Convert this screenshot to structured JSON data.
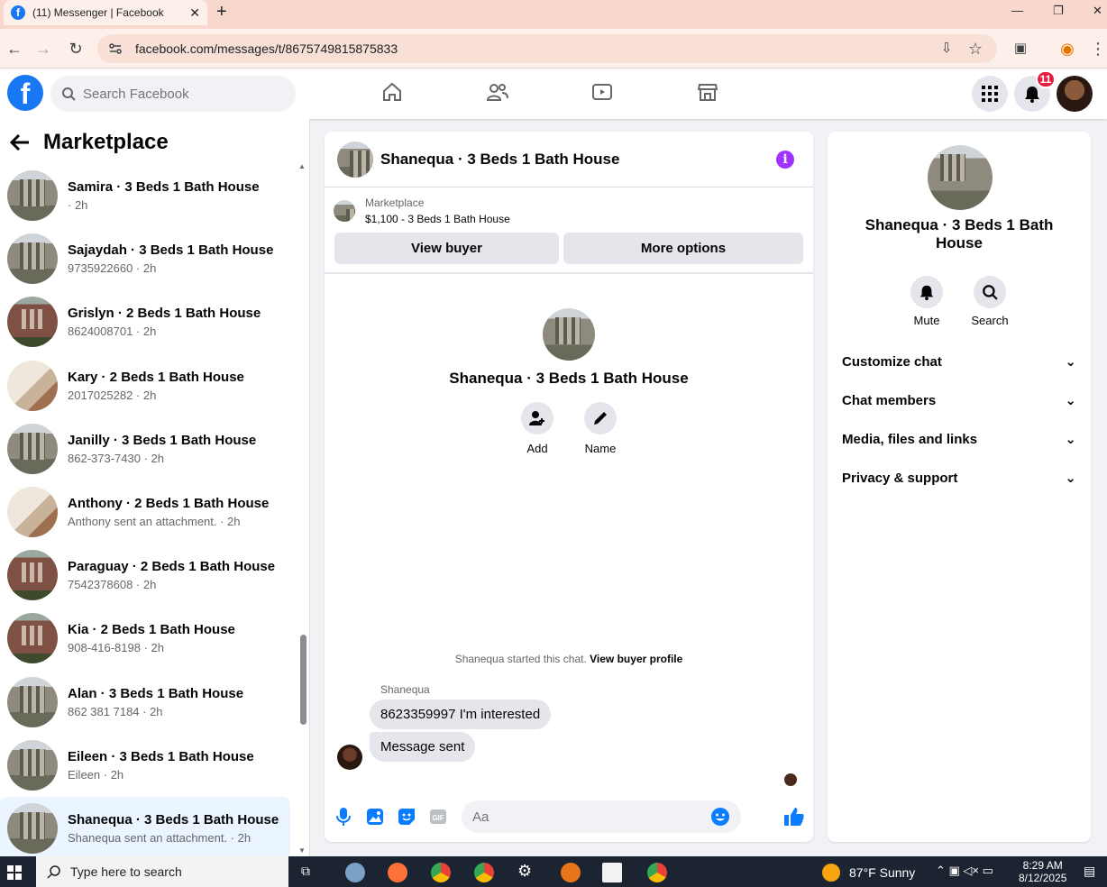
{
  "browser": {
    "tab_title": "(11) Messenger | Facebook",
    "url": "facebook.com/messages/t/8675749815875833"
  },
  "fb": {
    "search_placeholder": "Search Facebook",
    "notification_count": "11"
  },
  "left": {
    "title": "Marketplace",
    "conversations": [
      {
        "name": "Samira · 3 Beds 1 Bath House",
        "sub": "· 2h",
        "thumb": "house"
      },
      {
        "name": "Sajaydah · 3 Beds 1 Bath House",
        "sub": "9735922660 · 2h",
        "thumb": "house"
      },
      {
        "name": "Grislyn · 2 Beds 1 Bath House",
        "sub": "8624008701 · 2h",
        "thumb": "brick"
      },
      {
        "name": "Kary · 2 Beds 1 Bath House",
        "sub": "2017025282 · 2h",
        "thumb": "room"
      },
      {
        "name": "Janilly · 3 Beds 1 Bath House",
        "sub": "862-373-7430 · 2h",
        "thumb": "house"
      },
      {
        "name": "Anthony · 2 Beds 1 Bath House",
        "sub": "Anthony sent an attachment. · 2h",
        "thumb": "room"
      },
      {
        "name": "Paraguay · 2 Beds 1 Bath House",
        "sub": "7542378608 · 2h",
        "thumb": "brick"
      },
      {
        "name": "Kia · 2 Beds 1 Bath House",
        "sub": "908-416-8198 · 2h",
        "thumb": "brick"
      },
      {
        "name": "Alan · 3 Beds 1 Bath House",
        "sub": "862 381 7184 · 2h",
        "thumb": "house"
      },
      {
        "name": "Eileen · 3 Beds 1 Bath House",
        "sub": "Eileen · 2h",
        "thumb": "house"
      },
      {
        "name": "Shanequa · 3 Beds 1 Bath House",
        "sub": "Shanequa sent an attachment. · 2h",
        "thumb": "house"
      }
    ]
  },
  "chat": {
    "title": "Shanequa · 3 Beds 1 Bath House",
    "marketplace_label": "Marketplace",
    "listing": "$1,100 - 3 Beds 1 Bath House",
    "view_buyer": "View buyer",
    "more_options": "More options",
    "profile_name": "Shanequa · 3 Beds 1 Bath House",
    "add_label": "Add",
    "name_label": "Name",
    "started_text": "Shanequa started this chat.",
    "view_profile": "View buyer profile",
    "sender": "Shanequa",
    "messages": [
      "8623359997 I'm interested",
      "Message sent"
    ],
    "composer_placeholder": "Aa"
  },
  "right": {
    "name": "Shanequa · 3 Beds 1 Bath House",
    "mute": "Mute",
    "search": "Search",
    "rows": [
      "Customize chat",
      "Chat members",
      "Media, files and links",
      "Privacy & support"
    ]
  },
  "taskbar": {
    "search_placeholder": "Type here to search",
    "weather": "87°F Sunny",
    "time": "8:29 AM",
    "date": "8/12/2025"
  }
}
